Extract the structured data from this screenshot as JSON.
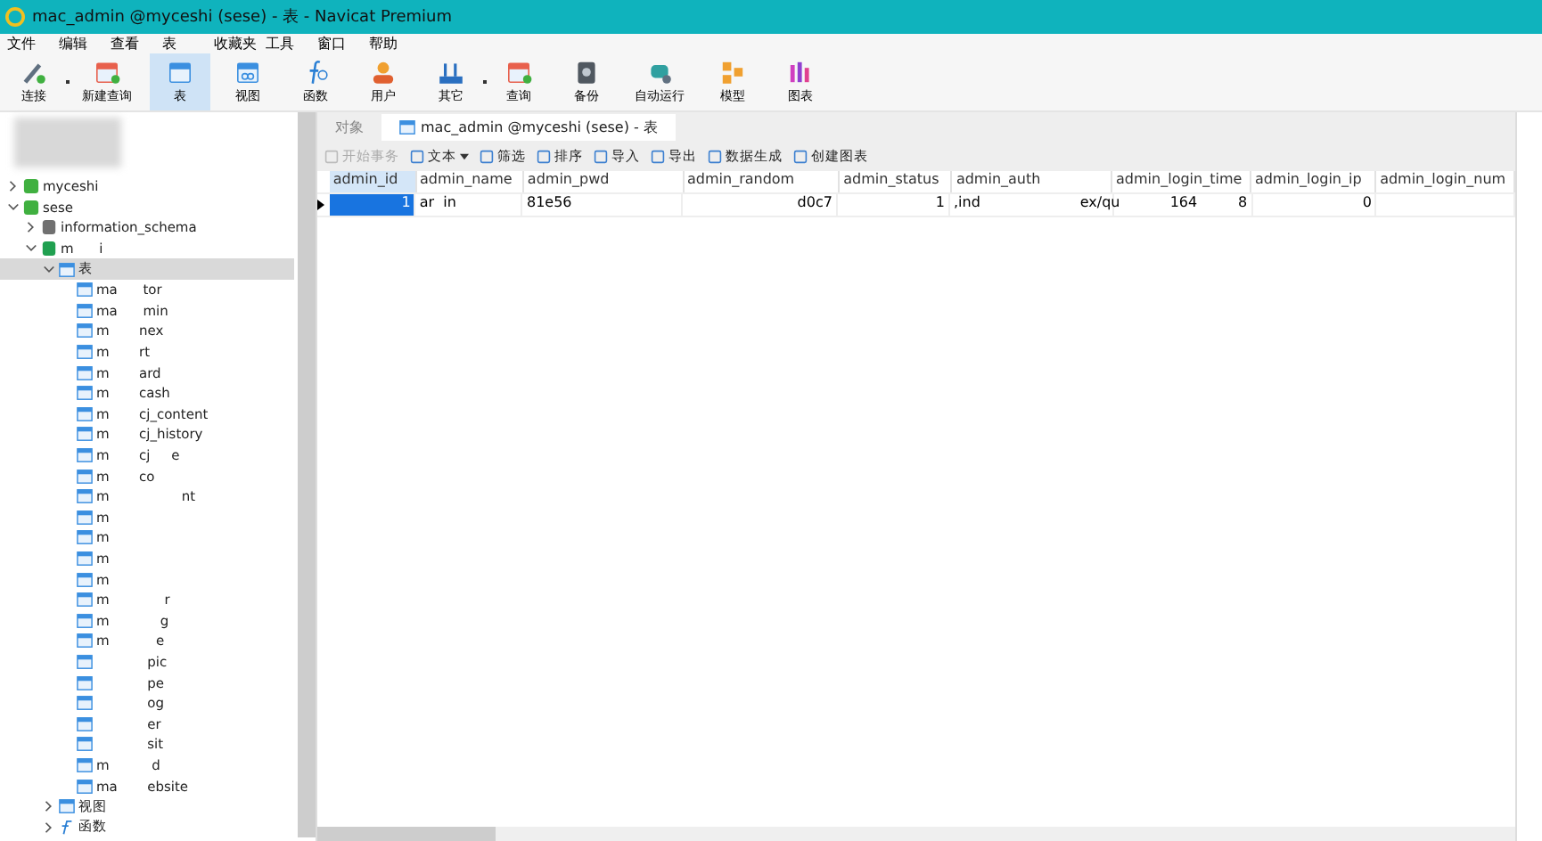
{
  "window": {
    "title": "mac_admin @myceshi (sese) - 表 - Navicat Premium"
  },
  "menu": [
    "文件",
    "编辑",
    "查看",
    "表",
    "收藏夹",
    "工具",
    "窗口",
    "帮助"
  ],
  "toolbar": [
    {
      "label": "连接",
      "kind": "plug",
      "dropdown": true,
      "selected": false
    },
    {
      "label": "新建查询",
      "kind": "query",
      "dropdown": false,
      "selected": false
    },
    {
      "label": "表",
      "kind": "table",
      "dropdown": false,
      "selected": true
    },
    {
      "label": "视图",
      "kind": "view",
      "dropdown": false,
      "selected": false
    },
    {
      "label": "函数",
      "kind": "function",
      "dropdown": false,
      "selected": false
    },
    {
      "label": "用户",
      "kind": "user",
      "dropdown": false,
      "selected": false
    },
    {
      "label": "其它",
      "kind": "other",
      "dropdown": true,
      "selected": false
    },
    {
      "label": "查询",
      "kind": "query",
      "dropdown": false,
      "selected": false
    },
    {
      "label": "备份",
      "kind": "backup",
      "dropdown": false,
      "selected": false
    },
    {
      "label": "自动运行",
      "kind": "robot",
      "dropdown": false,
      "selected": false
    },
    {
      "label": "模型",
      "kind": "model",
      "dropdown": false,
      "selected": false
    },
    {
      "label": "图表",
      "kind": "chart",
      "dropdown": false,
      "selected": false
    }
  ],
  "sidebar": {
    "tree": [
      {
        "label": "myceshi",
        "kind": "connection",
        "expanded": false,
        "selected": false
      },
      {
        "label": "sese",
        "kind": "connection",
        "expanded": true,
        "selected": false,
        "children": [
          {
            "label": "information_schema",
            "kind": "database",
            "expanded": false,
            "selected": false
          },
          {
            "label": "m      i",
            "kind": "database-open",
            "expanded": true,
            "selected": false,
            "children": [
              {
                "label": "表",
                "kind": "folder",
                "expanded": true,
                "selected": true,
                "children": [
                  {
                    "label": "ma      tor"
                  },
                  {
                    "label": "ma      min"
                  },
                  {
                    "label": "m       nex"
                  },
                  {
                    "label": "m       rt"
                  },
                  {
                    "label": "m       ard"
                  },
                  {
                    "label": "m       cash"
                  },
                  {
                    "label": "m       cj_content"
                  },
                  {
                    "label": "m       cj_history"
                  },
                  {
                    "label": "m       cj     e"
                  },
                  {
                    "label": "m       co"
                  },
                  {
                    "label": "m                 nt"
                  },
                  {
                    "label": "m"
                  },
                  {
                    "label": "m"
                  },
                  {
                    "label": "m"
                  },
                  {
                    "label": "m"
                  },
                  {
                    "label": "m             r"
                  },
                  {
                    "label": "m            g"
                  },
                  {
                    "label": "m           e"
                  },
                  {
                    "label": "            pic"
                  },
                  {
                    "label": "            pe"
                  },
                  {
                    "label": "            og"
                  },
                  {
                    "label": "            er"
                  },
                  {
                    "label": "            sit"
                  },
                  {
                    "label": "m          d"
                  },
                  {
                    "label": "ma       ebsite"
                  }
                ]
              },
              {
                "label": "视图",
                "kind": "views",
                "expanded": false,
                "selected": false
              },
              {
                "label": "函数",
                "kind": "functions",
                "expanded": false,
                "selected": false
              }
            ]
          }
        ]
      }
    ]
  },
  "tabs": [
    {
      "label": "对象",
      "selected": false,
      "icon": false
    },
    {
      "label": "mac_admin @myceshi (sese) - 表",
      "selected": true,
      "icon": true
    }
  ],
  "actions": [
    {
      "label": "开始事务",
      "disabled": true,
      "dropdown": false
    },
    {
      "label": "文本",
      "disabled": false,
      "dropdown": true
    },
    {
      "label": "筛选",
      "disabled": false,
      "dropdown": false
    },
    {
      "label": "排序",
      "disabled": false,
      "dropdown": false
    },
    {
      "label": "导入",
      "disabled": false,
      "dropdown": false
    },
    {
      "label": "导出",
      "disabled": false,
      "dropdown": false
    },
    {
      "label": "数据生成",
      "disabled": false,
      "dropdown": false
    },
    {
      "label": "创建图表",
      "disabled": false,
      "dropdown": false
    }
  ],
  "table": {
    "columns": [
      "admin_id",
      "admin_name",
      "admin_pwd",
      "admin_random",
      "admin_status",
      "admin_auth",
      "admin_login_time",
      "admin_login_ip",
      "admin_login_num"
    ],
    "rows": [
      {
        "selected": true,
        "cells": [
          "1",
          "ar  in",
          "81e56",
          "d0c7",
          "1",
          ",ind                      ex/qu",
          "164         8",
          "0",
          ""
        ]
      }
    ]
  }
}
